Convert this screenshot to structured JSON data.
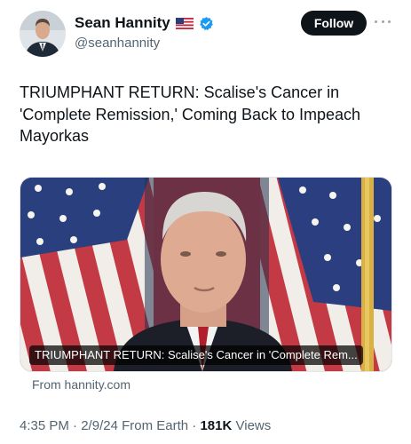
{
  "author": {
    "display_name": "Sean Hannity",
    "handle": "@seanhannity",
    "verified": true,
    "icons": {
      "flag": "us-flag-icon",
      "badge": "verified-badge-icon",
      "menu": "more-options-icon"
    }
  },
  "actions": {
    "follow_label": "Follow"
  },
  "tweet": {
    "text": "TRIUMPHANT RETURN: Scalise's Cancer in 'Complete Remission,' Coming Back to Impeach Mayorkas"
  },
  "card": {
    "caption": "TRIUMPHANT RETURN: Scalise's Cancer in 'Complete Rem...",
    "source": "From hannity.com"
  },
  "meta": {
    "time": "4:35 PM",
    "separator": "·",
    "date": "2/9/24",
    "client": "From Earth",
    "views_count": "181K",
    "views_label": "Views"
  },
  "colors": {
    "text_primary": "#0f1419",
    "text_secondary": "#536471",
    "verified_blue": "#1d9bf0",
    "follow_bg": "#0f1419"
  }
}
